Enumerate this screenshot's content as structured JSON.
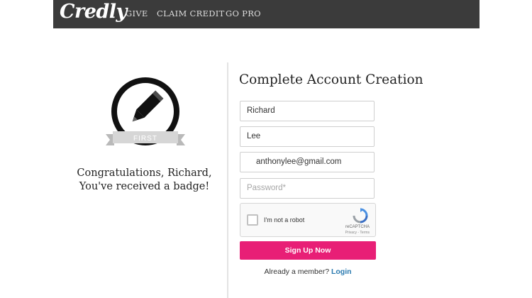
{
  "header": {
    "logo": "Credly",
    "nav": [
      "GIVE",
      "CLAIM CREDIT",
      "GO PRO"
    ]
  },
  "badge": {
    "ribbon_text": "FIRST",
    "icon": "pencil-icon"
  },
  "congrats": {
    "line1": "Congratulations, Richard,",
    "line2": "You've received a badge!"
  },
  "form": {
    "title": "Complete Account Creation",
    "first_name": "Richard",
    "last_name": "Lee",
    "email": "anthonylee@gmail.com",
    "password_placeholder": "Password*",
    "captcha": {
      "label": "I'm not a robot",
      "brand": "reCAPTCHA",
      "terms": "Privacy - Terms"
    },
    "submit_label": "Sign Up Now",
    "member_text": "Already a member?",
    "login_label": "Login"
  },
  "colors": {
    "header_bg": "#3b3b3b",
    "accent": "#e81f76",
    "link": "#2a7ab0"
  }
}
